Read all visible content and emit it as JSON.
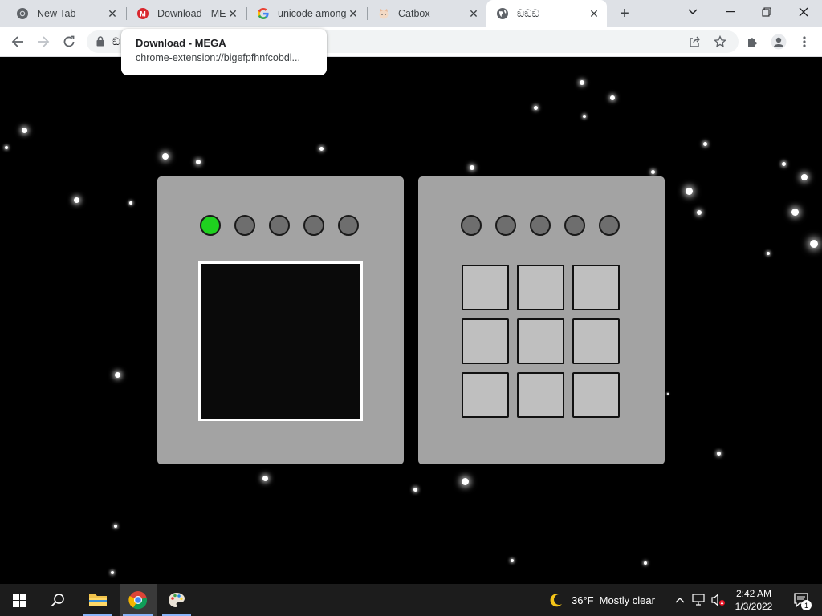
{
  "browser": {
    "tabs": [
      {
        "title": "New Tab",
        "active": false,
        "favicon": "chrome-icon"
      },
      {
        "title": "Download - ME",
        "active": false,
        "favicon": "mega-icon"
      },
      {
        "title": "unicode among",
        "active": false,
        "favicon": "google-icon"
      },
      {
        "title": "Catbox",
        "active": false,
        "favicon": "catbox-icon"
      },
      {
        "title": "ඞඞඞ",
        "active": true,
        "favicon": "globe-icon"
      }
    ],
    "address_text": "ඞ",
    "tooltip": {
      "title": "Download - MEGA",
      "url": "chrome-extension://bigefpfhnfcobdl..."
    }
  },
  "game": {
    "left_lights": [
      "on",
      "off",
      "off",
      "off",
      "off"
    ],
    "right_lights": [
      "off",
      "off",
      "off",
      "off",
      "off"
    ],
    "colors": {
      "light_on": "#1fd11f",
      "light_off": "#6e6e6e",
      "panel": "#a3a3a3",
      "cell": "#bfbfbf",
      "screen": "#0a0a0a"
    }
  },
  "taskbar": {
    "weather_temp": "36°F",
    "weather_desc": "Mostly clear",
    "time": "2:42 AM",
    "date": "1/3/2022",
    "notification_count": "1"
  }
}
